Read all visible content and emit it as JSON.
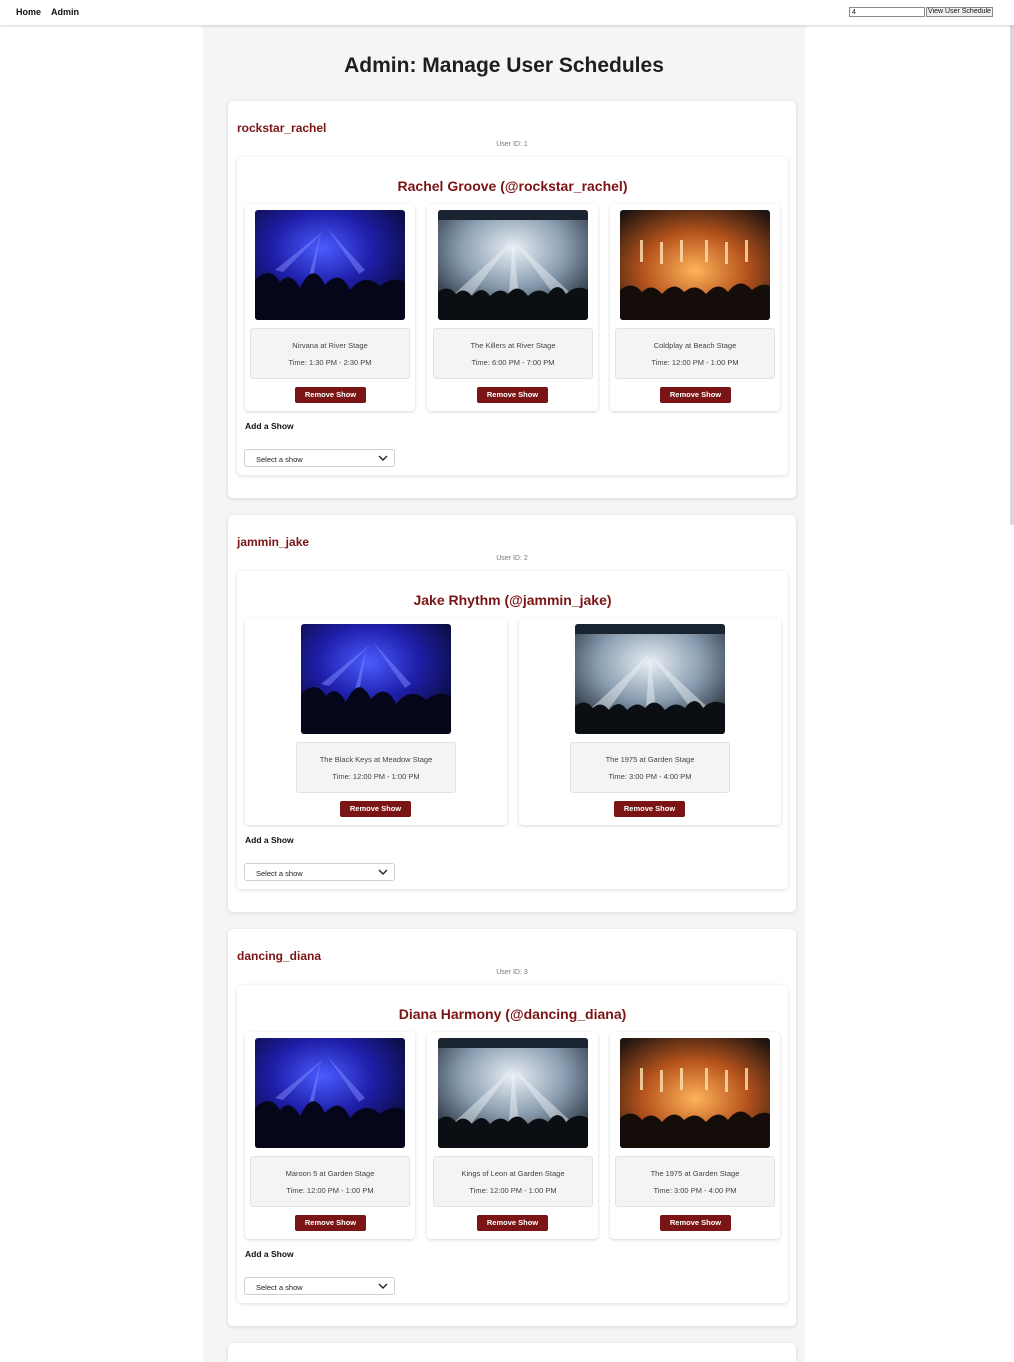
{
  "nav": {
    "home": "Home",
    "admin": "Admin",
    "user_id_value": "4",
    "view_button": "View User Schedule"
  },
  "page": {
    "title": "Admin: Manage User Schedules"
  },
  "users": [
    {
      "username": "rockstar_rachel",
      "user_id": "User ID: 1",
      "schedule_title": "Rachel Groove (@rockstar_rachel)",
      "add_label": "Add a Show",
      "select_placeholder": "Select a show",
      "remove_label": "Remove Show",
      "shows": [
        {
          "name": "Nirvana at River Stage",
          "time": "Time: 1:30 PM - 2:30 PM",
          "image": "blue-lights-concert"
        },
        {
          "name": "The Killers at River Stage",
          "time": "Time: 6:00 PM - 7:00 PM",
          "image": "white-stage-crowd"
        },
        {
          "name": "Coldplay at Beach Stage",
          "time": "Time: 12:00 PM - 1:00 PM",
          "image": "orange-pyro-stage"
        }
      ]
    },
    {
      "username": "jammin_jake",
      "user_id": "User ID: 2",
      "schedule_title": "Jake Rhythm (@jammin_jake)",
      "add_label": "Add a Show",
      "select_placeholder": "Select a show",
      "remove_label": "Remove Show",
      "shows": [
        {
          "name": "The Black Keys at Meadow Stage",
          "time": "Time: 12:00 PM - 1:00 PM",
          "image": "blue-lights-concert"
        },
        {
          "name": "The 1975 at Garden Stage",
          "time": "Time: 3:00 PM - 4:00 PM",
          "image": "white-stage-crowd"
        }
      ]
    },
    {
      "username": "dancing_diana",
      "user_id": "User ID: 3",
      "schedule_title": "Diana Harmony (@dancing_diana)",
      "add_label": "Add a Show",
      "select_placeholder": "Select a show",
      "remove_label": "Remove Show",
      "shows": [
        {
          "name": "Maroon 5 at Garden Stage",
          "time": "Time: 12:00 PM - 1:00 PM",
          "image": "blue-lights-concert"
        },
        {
          "name": "Kings of Leon at Garden Stage",
          "time": "Time: 12:00 PM - 1:00 PM",
          "image": "white-stage-crowd"
        },
        {
          "name": "The 1975 at Garden Stage",
          "time": "Time: 3:00 PM - 4:00 PM",
          "image": "orange-pyro-stage"
        }
      ]
    }
  ],
  "colors": {
    "accent": "#7b1515",
    "panel": "#f5f5f5"
  }
}
